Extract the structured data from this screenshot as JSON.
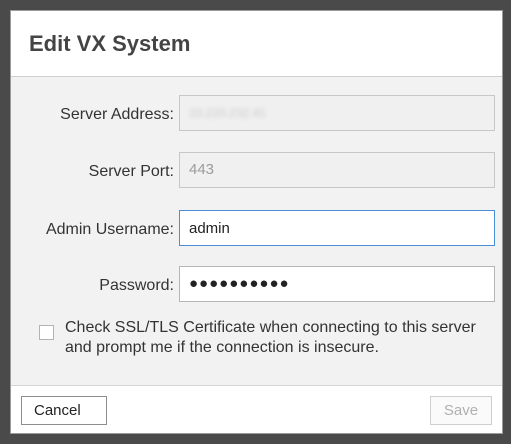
{
  "dialog": {
    "title": "Edit VX System"
  },
  "form": {
    "server_address": {
      "label": "Server Address:",
      "value": "10.220.232.41"
    },
    "server_port": {
      "label": "Server Port:",
      "value": "443"
    },
    "admin_username": {
      "label": "Admin Username:",
      "value": "admin"
    },
    "password": {
      "label": "Password:",
      "value": "●●●●●●●●●●"
    }
  },
  "certificate_check": {
    "label": "Check SSL/TLS Certificate when connecting to this server and prompt me if the connection is insecure.",
    "checked": false
  },
  "footer": {
    "cancel_label": "Cancel",
    "save_label": "Save"
  },
  "colors": {
    "focus_border": "#4b8fd6",
    "background": "#4a4a4a"
  }
}
